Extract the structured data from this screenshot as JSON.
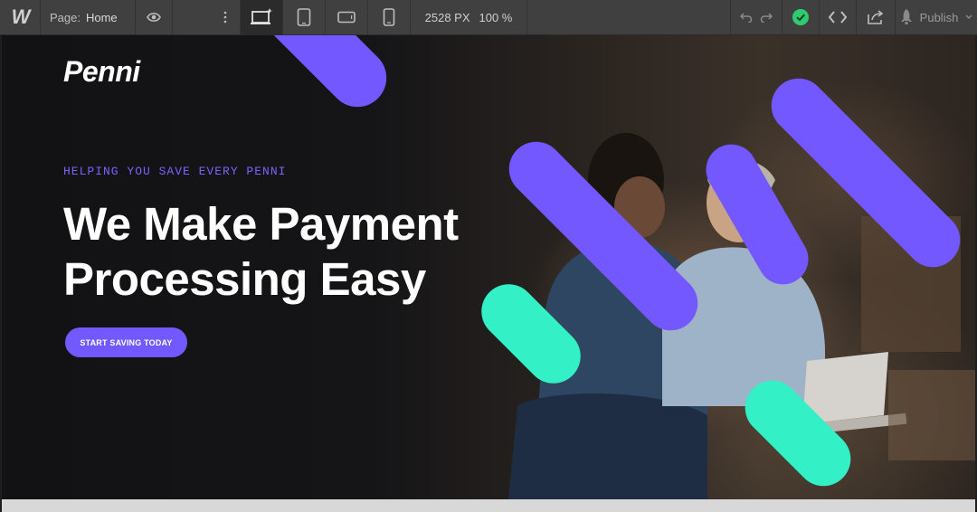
{
  "toolbar": {
    "logo": "W",
    "page_label": "Page:",
    "page_name": "Home",
    "dims": "2528 PX",
    "zoom": "100 %",
    "publish_label": "Publish",
    "status_color": "#2ecc71"
  },
  "hero": {
    "brand": "Penni",
    "eyebrow": "HELPING YOU SAVE EVERY PENNI",
    "headline_line1": "We Make Payment",
    "headline_line2": "Processing Easy",
    "cta_label": "START SAVING TODAY",
    "accent_purple": "#7458ff",
    "accent_mint": "#33f0c6"
  }
}
